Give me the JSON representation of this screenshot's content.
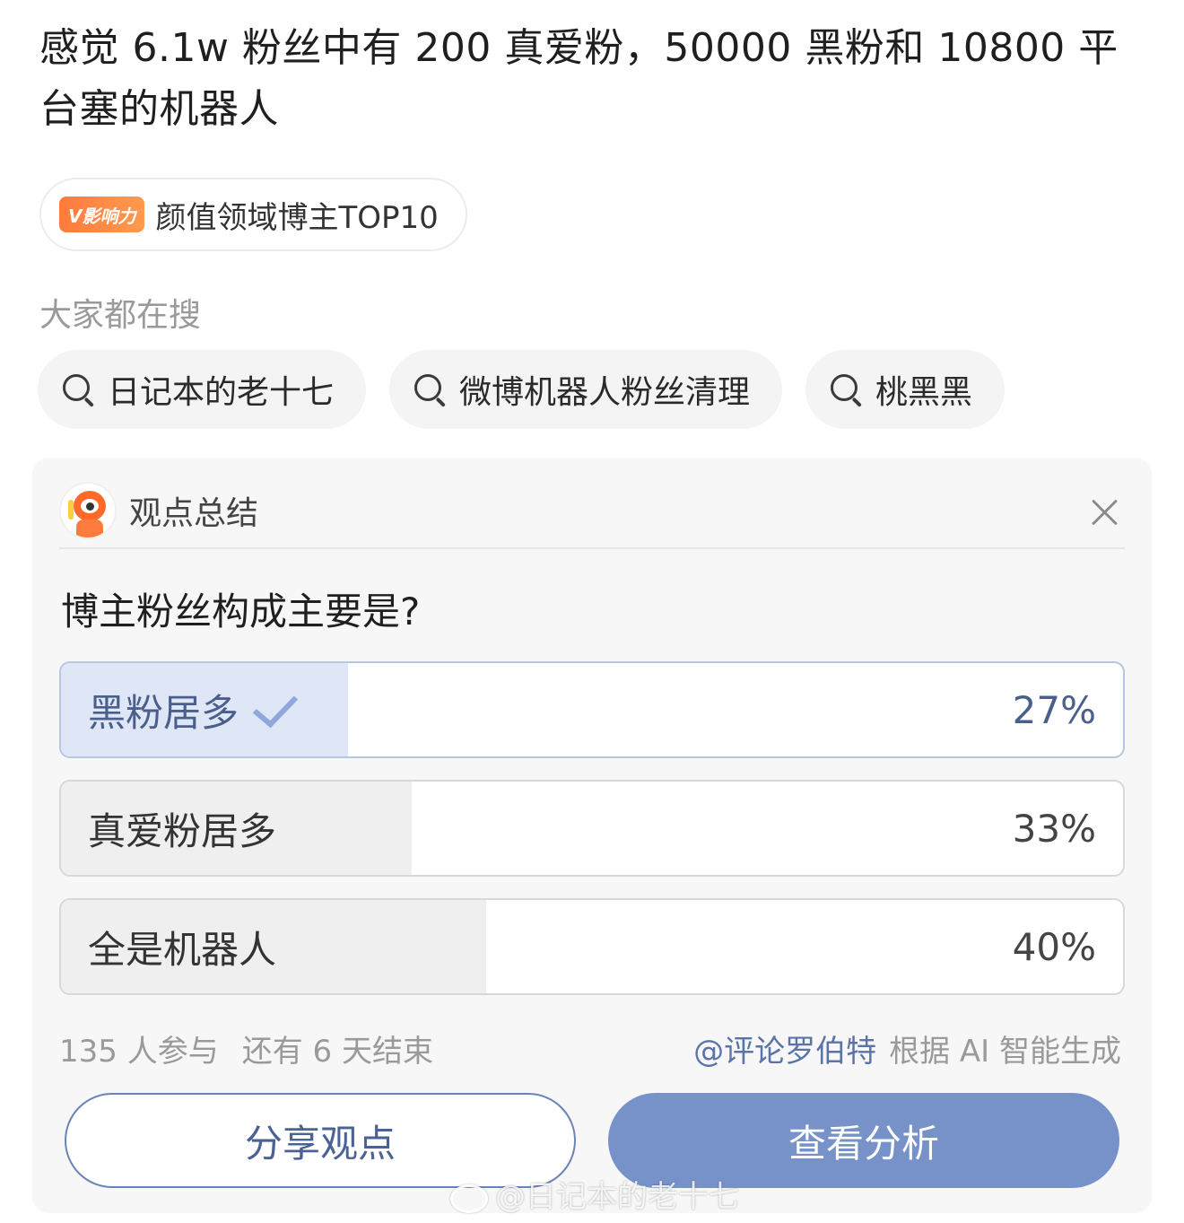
{
  "post": {
    "text": "感觉 6.1w 粉丝中有 200 真爱粉，50000 黑粉和 10800 平台塞的机器人"
  },
  "influence_badge": {
    "tag": "V影响力",
    "text": "颜值领域博主TOP10"
  },
  "hot_search": {
    "title": "大家都在搜",
    "items": [
      {
        "label": "日记本的老十七",
        "icon": "search-icon"
      },
      {
        "label": "微博机器人粉丝清理",
        "icon": "search-icon"
      },
      {
        "label": "桃黑黑",
        "icon": "search-icon"
      }
    ]
  },
  "poll_card": {
    "title": "观点总结",
    "question": "博主粉丝构成主要是?",
    "options": [
      {
        "label": "黑粉居多",
        "percent_text": "27%",
        "percent": 27,
        "selected": true
      },
      {
        "label": "真爱粉居多",
        "percent_text": "33%",
        "percent": 33,
        "selected": false
      },
      {
        "label": "全是机器人",
        "percent_text": "40%",
        "percent": 40,
        "selected": false
      }
    ],
    "participants": "135 人参与",
    "remaining": "还有 6 天结束",
    "source_mention": "@评论罗伯特",
    "source_suffix": "根据 AI 智能生成",
    "share_button": "分享观点",
    "analysis_button": "查看分析"
  },
  "watermark": {
    "text": "@日记本的老十七"
  },
  "colors": {
    "accent_blue": "#7692c9",
    "selected_fill": "#dfe7f6",
    "badge_orange": "#ff7a3d",
    "muted_text": "#9a9a9a"
  }
}
